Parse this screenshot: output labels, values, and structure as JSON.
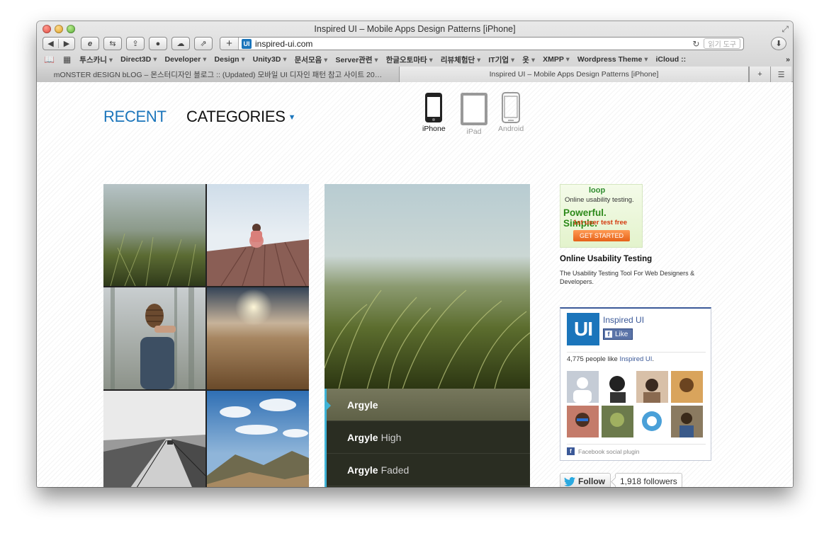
{
  "window": {
    "title": "Inspired UI – Mobile Apps Design Patterns [iPhone]"
  },
  "toolbar": {
    "url": "inspired-ui.com",
    "favicon": "UI",
    "reader_label": "읽기 도구"
  },
  "bookmarks": [
    "투스카니",
    "Direct3D",
    "Developer",
    "Design",
    "Unity3D",
    "문서모음",
    "Server관련",
    "한글오토마타",
    "리뷰체험단",
    "IT기업",
    "옷",
    "XMPP",
    "Wordpress Theme",
    "iCloud ::"
  ],
  "bookmarks_more": "»",
  "tabs": {
    "inactive": "mONSTER dESIGN bLOG – 몬스터디자인 블로그 :: (Updated) 모바일 UI 디자인 패턴 참고 사이트 20…",
    "active": "Inspired UI – Mobile Apps Design Patterns [iPhone]"
  },
  "nav": {
    "recent": "RECENT",
    "categories": "CATEGORIES",
    "categories_arrow": "▼"
  },
  "devices": [
    {
      "label": "iPhone",
      "selected": true
    },
    {
      "label": "iPad",
      "selected": false
    },
    {
      "label": "Android",
      "selected": false
    }
  ],
  "detail_menu": [
    {
      "bold": "Argyle",
      "light": "",
      "selected": true
    },
    {
      "bold": "Argyle",
      "light": "High",
      "selected": false
    },
    {
      "bold": "Argyle",
      "light": "Faded",
      "selected": false
    }
  ],
  "ad": {
    "logo": "loop",
    "line1": "Online usability testing.",
    "line2": "Powerful. Simple.",
    "line3": "1st user test free",
    "cta": "GET STARTED",
    "title": "Online Usability Testing",
    "description": "The Usability Testing Tool For Web Designers & Developers."
  },
  "facebook": {
    "logo": "UI",
    "page_name": "Inspired UI",
    "like_label": "Like",
    "count_text": "4,775 people like ",
    "count_link": "Inspired UI",
    "count_end": ".",
    "footer": "Facebook social plugin"
  },
  "twitter": {
    "follow_label": "Follow",
    "followers": "1,918 followers"
  },
  "colors": {
    "accent": "#1b75bb",
    "facebook": "#3b5998",
    "menu_accent": "#3fb3d6"
  }
}
